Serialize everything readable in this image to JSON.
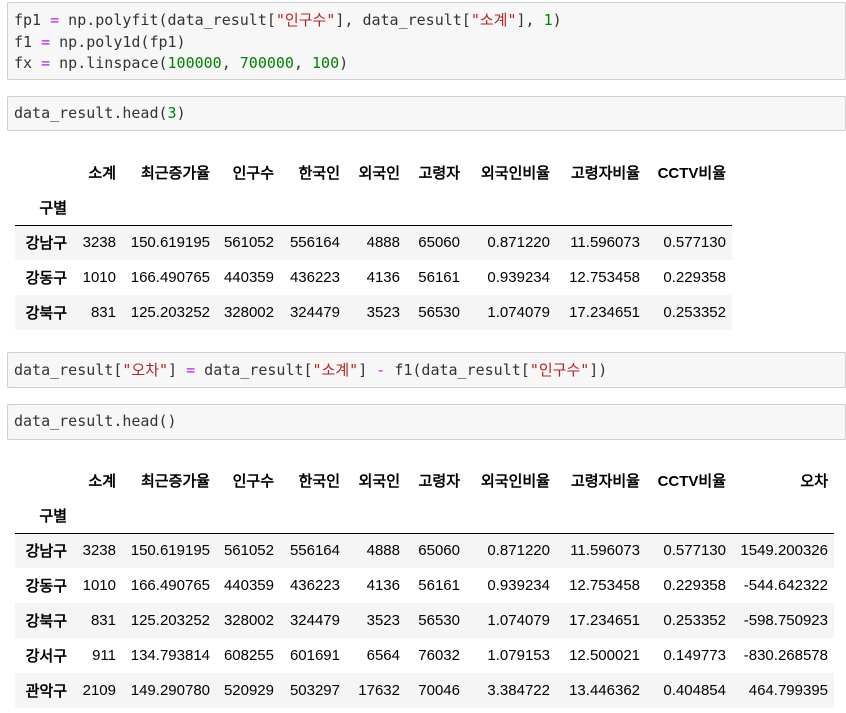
{
  "syntax_colors": {
    "text": "#333333",
    "string": "#ba2121",
    "number": "#008000",
    "operator": "#aa22ff"
  },
  "notebook": {
    "code_cells": [
      {
        "lines": [
          [
            {
              "txt": "fp1 "
            },
            {
              "op": "="
            },
            {
              "txt": " np.polyfit(data_result["
            },
            {
              "str": "\"인구수\""
            },
            {
              "txt": "], data_result["
            },
            {
              "str": "\"소계\""
            },
            {
              "txt": "], "
            },
            {
              "num": "1"
            },
            {
              "txt": ")"
            }
          ],
          [
            {
              "txt": "f1 "
            },
            {
              "op": "="
            },
            {
              "txt": " np.poly1d(fp1)"
            }
          ],
          [
            {
              "txt": "fx "
            },
            {
              "op": "="
            },
            {
              "txt": " np.linspace("
            },
            {
              "num": "100000"
            },
            {
              "txt": ", "
            },
            {
              "num": "700000"
            },
            {
              "txt": ", "
            },
            {
              "num": "100"
            },
            {
              "txt": ")"
            }
          ]
        ]
      },
      {
        "lines": [
          [
            {
              "txt": "data_result.head("
            },
            {
              "num": "3"
            },
            {
              "txt": ")"
            }
          ]
        ]
      },
      {
        "lines": [
          [
            {
              "txt": "data_result["
            },
            {
              "str": "\"오차\""
            },
            {
              "txt": "] "
            },
            {
              "op": "="
            },
            {
              "txt": " data_result["
            },
            {
              "str": "\"소계\""
            },
            {
              "txt": "] "
            },
            {
              "op": "-"
            },
            {
              "txt": " f1(data_result["
            },
            {
              "str": "\"인구수\""
            },
            {
              "txt": "])"
            }
          ]
        ]
      },
      {
        "lines": [
          [
            {
              "txt": "data_result.head()"
            }
          ]
        ]
      }
    ],
    "outputs": [
      {
        "index_name": "구별",
        "columns": [
          "소계",
          "최근증가율",
          "인구수",
          "한국인",
          "외국인",
          "고령자",
          "외국인비율",
          "고령자비율",
          "CCTV비율"
        ],
        "rows": [
          {
            "label": "강남구",
            "values": [
              "3238",
              "150.619195",
              "561052",
              "556164",
              "4888",
              "65060",
              "0.871220",
              "11.596073",
              "0.577130"
            ]
          },
          {
            "label": "강동구",
            "values": [
              "1010",
              "166.490765",
              "440359",
              "436223",
              "4136",
              "56161",
              "0.939234",
              "12.753458",
              "0.229358"
            ]
          },
          {
            "label": "강북구",
            "values": [
              "831",
              "125.203252",
              "328002",
              "324479",
              "3523",
              "56530",
              "1.074079",
              "17.234651",
              "0.253352"
            ]
          }
        ]
      },
      {
        "index_name": "구별",
        "columns": [
          "소계",
          "최근증가율",
          "인구수",
          "한국인",
          "외국인",
          "고령자",
          "외국인비율",
          "고령자비율",
          "CCTV비율",
          "오차"
        ],
        "rows": [
          {
            "label": "강남구",
            "values": [
              "3238",
              "150.619195",
              "561052",
              "556164",
              "4888",
              "65060",
              "0.871220",
              "11.596073",
              "0.577130",
              "1549.200326"
            ]
          },
          {
            "label": "강동구",
            "values": [
              "1010",
              "166.490765",
              "440359",
              "436223",
              "4136",
              "56161",
              "0.939234",
              "12.753458",
              "0.229358",
              "-544.642322"
            ]
          },
          {
            "label": "강북구",
            "values": [
              "831",
              "125.203252",
              "328002",
              "324479",
              "3523",
              "56530",
              "1.074079",
              "17.234651",
              "0.253352",
              "-598.750923"
            ]
          },
          {
            "label": "강서구",
            "values": [
              "911",
              "134.793814",
              "608255",
              "601691",
              "6564",
              "76032",
              "1.079153",
              "12.500021",
              "0.149773",
              "-830.268578"
            ]
          },
          {
            "label": "관악구",
            "values": [
              "2109",
              "149.290780",
              "520929",
              "503297",
              "17632",
              "70046",
              "3.384722",
              "13.446362",
              "0.404854",
              "464.799395"
            ]
          }
        ]
      }
    ]
  }
}
